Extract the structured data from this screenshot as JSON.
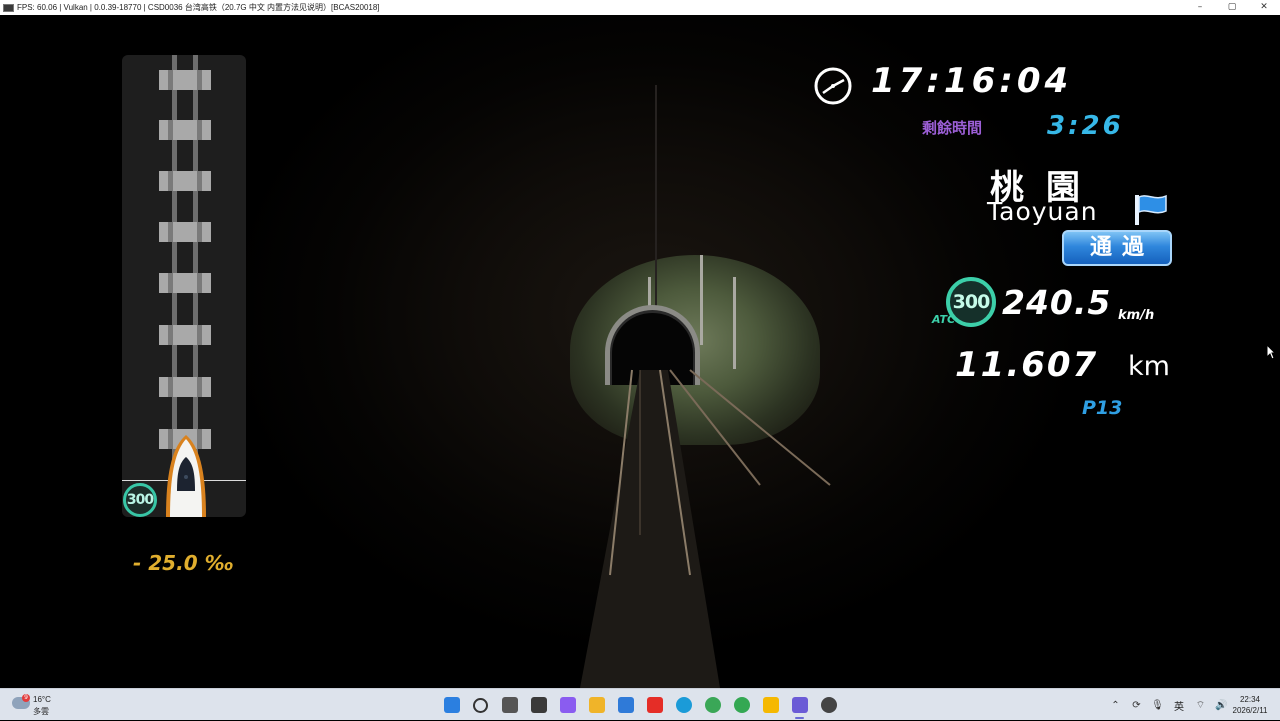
{
  "window": {
    "title": "FPS: 60.06 | Vulkan | 0.0.39-18770 | CSD0036 台湾高铁（20.7G 中文 内置方法见说明）[BCAS20018]",
    "minimize": "–",
    "maximize": "▢",
    "close": "✕"
  },
  "hud": {
    "clock": "17:16:04",
    "remaining_label": "剩餘時間",
    "remaining_time": "3:26",
    "station_name_cn": "桃園",
    "station_name_en": "Taoyuan",
    "stop_type": "通過",
    "atc_limit": "300",
    "atc_label": "ATC",
    "speed": "240.5",
    "speed_unit": "km/h",
    "distance": "11.607",
    "distance_unit": "km",
    "point_code": "P13"
  },
  "gradient_panel": {
    "atc_limit": "300",
    "gradient": "- 25.0 ‰"
  },
  "taskbar": {
    "weather_temp": "16°C",
    "weather_desc": "多雲",
    "weather_badge": "9",
    "apps": [
      {
        "name": "start-button",
        "color": "#2b7fe0"
      },
      {
        "name": "search-button",
        "color": "#333333"
      },
      {
        "name": "task-view-button",
        "color": "#555555"
      },
      {
        "name": "app-goat",
        "color": "#3a3a3a"
      },
      {
        "name": "app-copilot",
        "color": "#8a5cf0"
      },
      {
        "name": "app-file-explorer",
        "color": "#f0b429"
      },
      {
        "name": "app-mail",
        "color": "#2f7ad8"
      },
      {
        "name": "app-youtube",
        "color": "#e52d27"
      },
      {
        "name": "app-edge",
        "color": "#1b9bd8"
      },
      {
        "name": "app-chrome",
        "color": "#3aa757"
      },
      {
        "name": "app-maps",
        "color": "#34a853"
      },
      {
        "name": "app-notes",
        "color": "#f5b800"
      },
      {
        "name": "app-text-editor",
        "color": "#6b5bd6"
      },
      {
        "name": "app-simulator",
        "color": "#444444"
      }
    ],
    "ime": "英",
    "time": "22:34",
    "date": "2026/2/11"
  }
}
